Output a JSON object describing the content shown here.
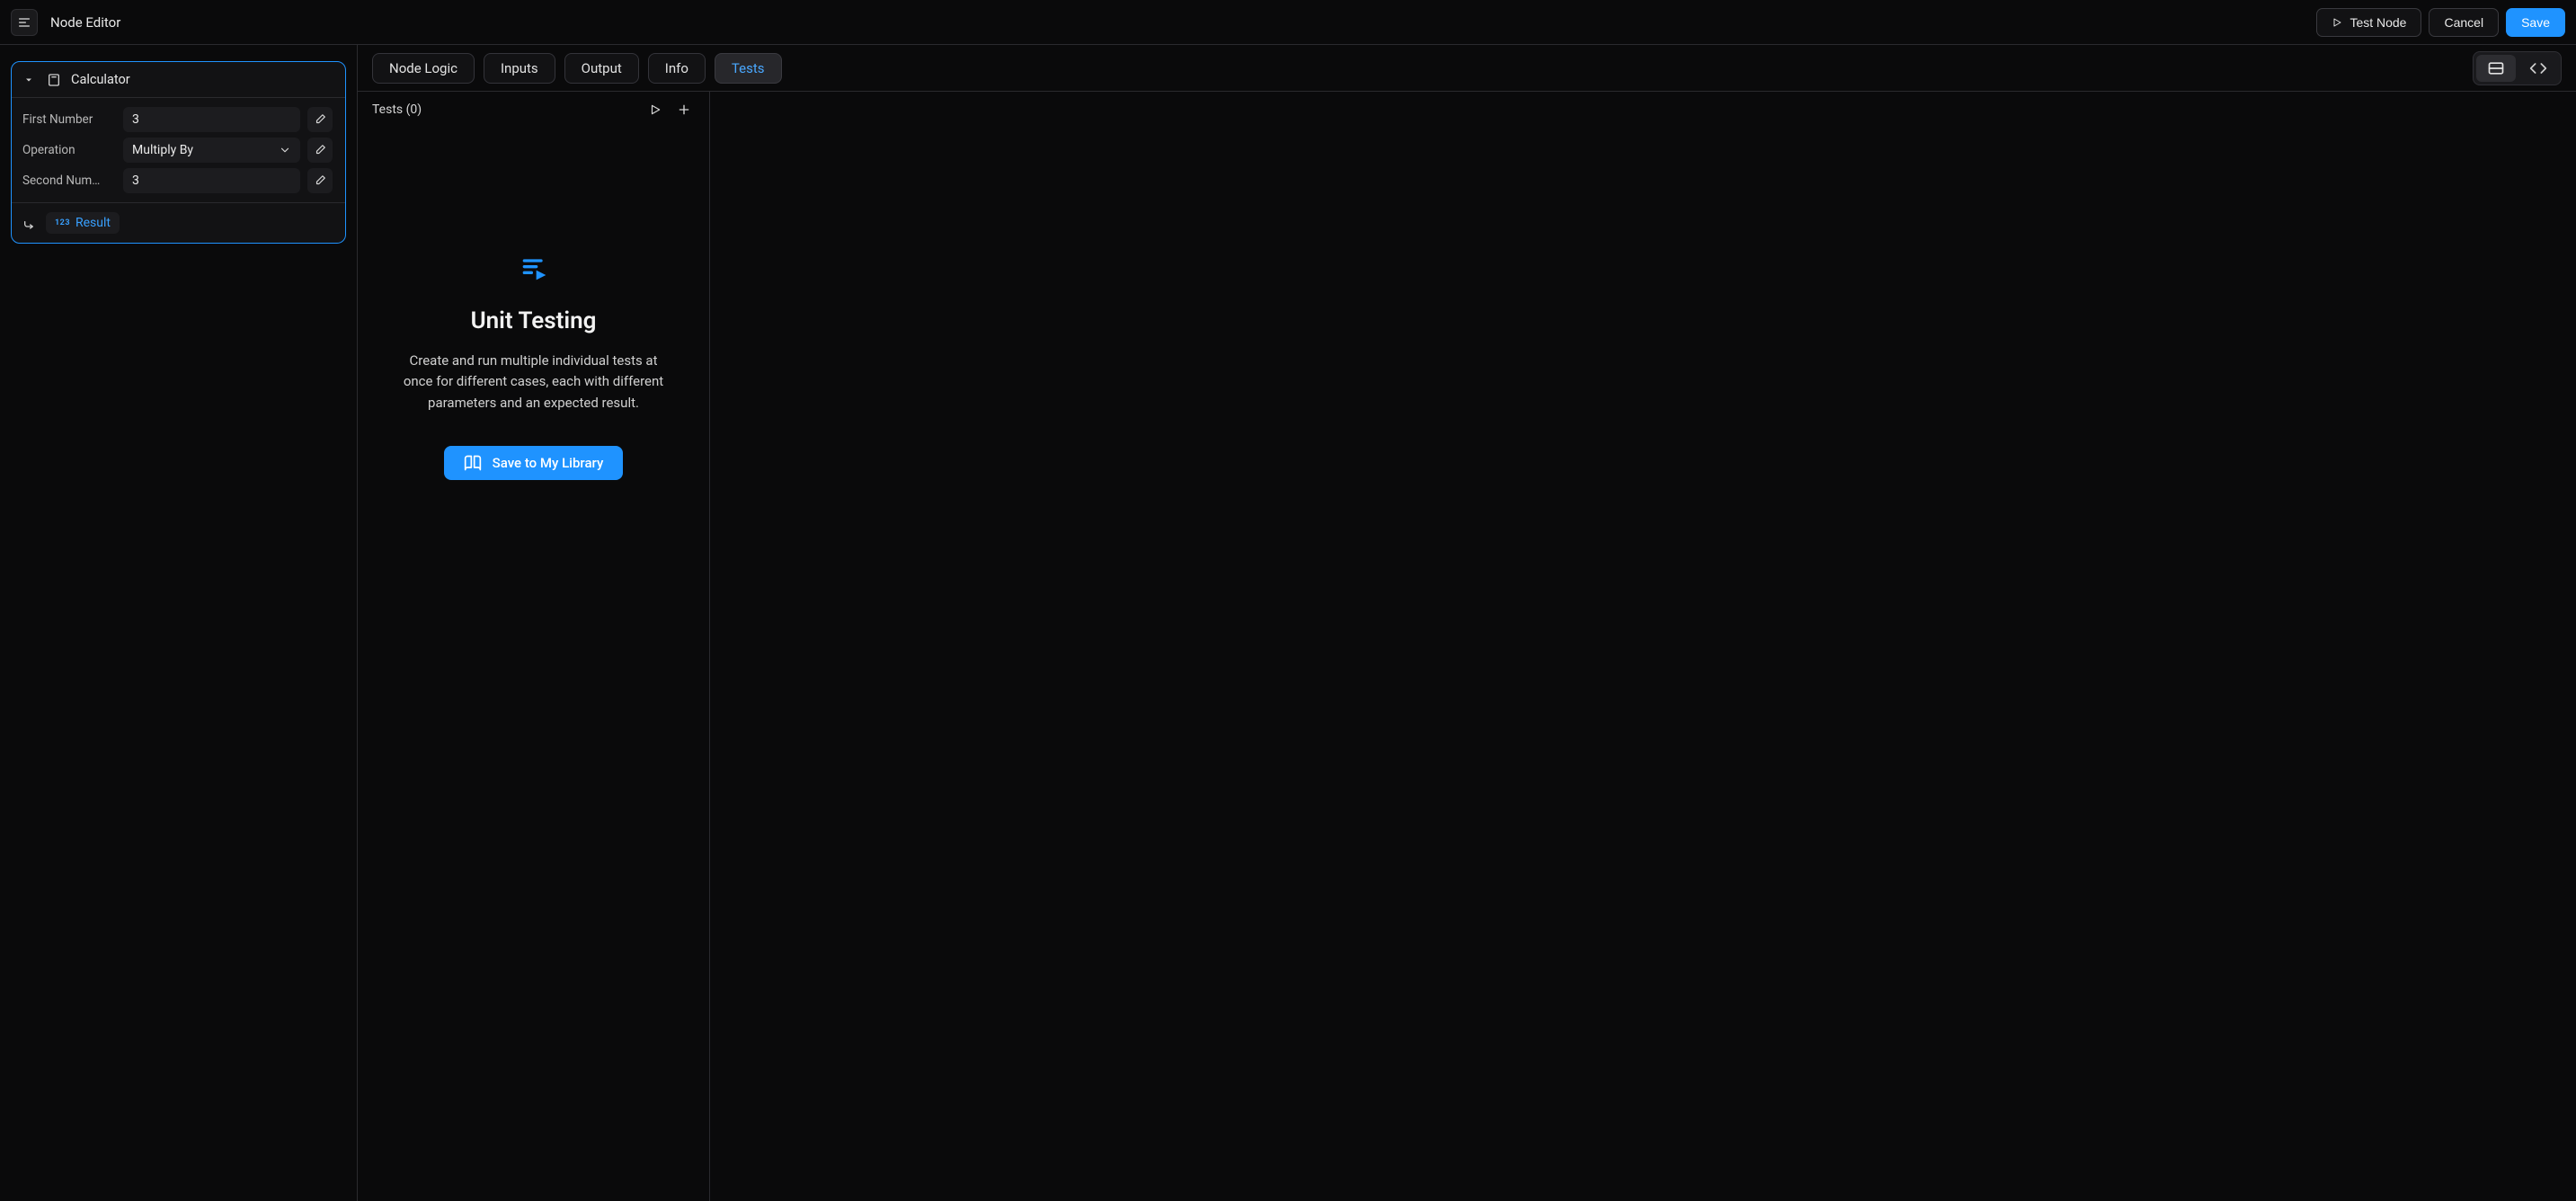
{
  "header": {
    "title": "Node Editor",
    "actions": {
      "test_node": "Test Node",
      "cancel": "Cancel",
      "save": "Save"
    }
  },
  "node": {
    "title": "Calculator",
    "params": {
      "first_number": {
        "label": "First Number",
        "value": "3"
      },
      "operation": {
        "label": "Operation",
        "value": "Multiply By"
      },
      "second_number": {
        "label": "Second Num…",
        "value": "3"
      }
    },
    "output": {
      "type_badge": "123",
      "label": "Result"
    }
  },
  "tabs": {
    "node_logic": "Node Logic",
    "inputs": "Inputs",
    "output": "Output",
    "info": "Info",
    "tests": "Tests",
    "active": "tests"
  },
  "tests_panel": {
    "header": "Tests (0)",
    "empty": {
      "title": "Unit Testing",
      "description": "Create and run multiple individual tests at once for different cases, each with different parameters and an expected result.",
      "cta": "Save to My Library"
    }
  },
  "colors": {
    "accent": "#1f93ff"
  }
}
